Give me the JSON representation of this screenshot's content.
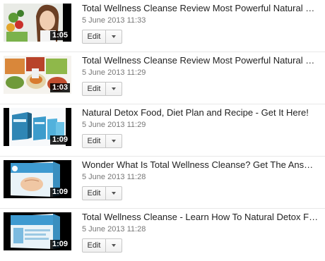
{
  "videos": [
    {
      "title": "Total Wellness Cleanse Review Most Powerful Natural Diet - Why...",
      "date": "5 June 2013 11:33",
      "duration": "1:05",
      "thumbnail_icon": "woman-with-vegetables-thumbnail",
      "edit_label": "Edit"
    },
    {
      "title": "Total Wellness Cleanse Review Most Powerful Natural Detox Diet",
      "date": "5 June 2013 11:29",
      "duration": "1:03",
      "thumbnail_icon": "healthy-food-collage-thumbnail",
      "edit_label": "Edit"
    },
    {
      "title": "Natural Detox Food, Diet Plan and Recipe - Get It Here!",
      "date": "5 June 2013 11:29",
      "duration": "1:09",
      "thumbnail_icon": "ebook-bundle-thumbnail",
      "edit_label": "Edit"
    },
    {
      "title": "Wonder What Is Total Wellness Cleanse? Get The Answer Here!",
      "date": "5 June 2013 11:28",
      "duration": "1:09",
      "thumbnail_icon": "cleanse-book-cover-thumbnail",
      "edit_label": "Edit"
    },
    {
      "title": "Total Wellness Cleanse - Learn How To Natural Detox For Better ...",
      "date": "5 June 2013 11:28",
      "duration": "1:09",
      "thumbnail_icon": "cleanse-book-cover-thumbnail",
      "edit_label": "Edit"
    }
  ]
}
